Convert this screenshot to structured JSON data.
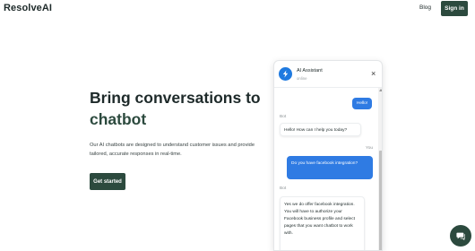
{
  "header": {
    "brand": "ResolveAI",
    "nav_blog": "Blog",
    "signin_label": "Sign in"
  },
  "hero": {
    "title_line1": "Bring conversations to",
    "title_line2": "chatbot",
    "description": "Our AI chatbots are designed to understand customer issues and provide tailored, accurate responses in real-time.",
    "cta_label": "Get started"
  },
  "chat": {
    "assistant_name": "AI Assistant",
    "status": "online",
    "close_glyph": "×",
    "avatar_icon": "lightning-icon",
    "messages": [
      {
        "sender": "",
        "text": "Hello!",
        "role": "user"
      },
      {
        "sender": "Bot",
        "text": "Hello! How can I help you today?",
        "role": "bot"
      },
      {
        "sender": "You",
        "text": "Do you have facebook integration?",
        "role": "user"
      },
      {
        "sender": "Bot",
        "text": "Yes we do offer facebook integration. You will have to authorize your Facebook business profile and select pages that you want chatbot to work with.",
        "role": "bot"
      }
    ]
  },
  "fab": {
    "icon": "chat-bubble-icon"
  },
  "colors": {
    "brand_green": "#2c4a3e",
    "user_bubble": "#2f7be3",
    "avatar_blue": "#1f7ae0"
  }
}
